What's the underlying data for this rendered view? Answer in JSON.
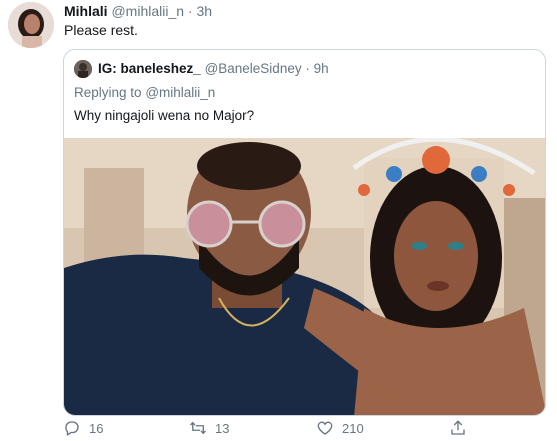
{
  "tweet": {
    "author_name": "Mihlali",
    "author_handle": "@mihlalii_n",
    "separator": "·",
    "time": "3h",
    "text": "Please rest."
  },
  "quoted": {
    "author_name": "IG: baneleshez_",
    "author_handle": "@BaneleSidney",
    "separator": "·",
    "time": "9h",
    "replying_prefix": "Replying to",
    "replying_to": "@mihlalii_n",
    "text": "Why ningajoli wena no Major?"
  },
  "actions": {
    "replies": "16",
    "retweets": "13",
    "likes": "210"
  },
  "colors": {
    "secondary_text": "#657786",
    "primary_text": "#14171a",
    "border": "#ccd6dd"
  }
}
